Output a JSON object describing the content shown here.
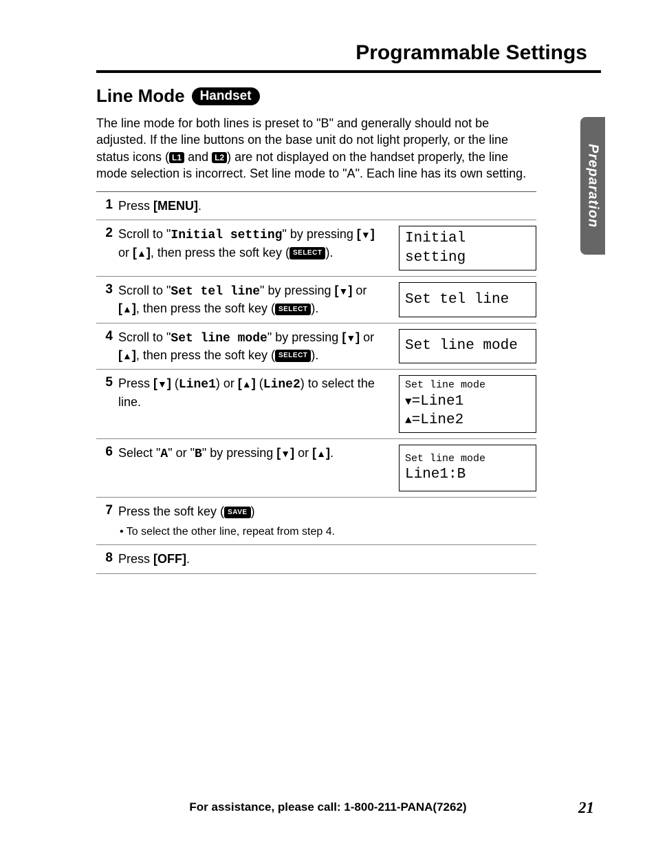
{
  "chapter_title": "Programmable Settings",
  "section": {
    "title": "Line Mode",
    "pill": "Handset"
  },
  "side_tab": "Preparation",
  "intro": {
    "p1a": "The line mode for both lines is preset to \"B\" and generally should not be adjusted. If the line buttons on the base unit do not light properly, or the line status icons (",
    "chip1": "L1",
    "p1b": " and ",
    "chip2": "L2",
    "p1c": ") are not displayed on the handset properly, the line mode selection is incorrect. Set line mode to \"A\". Each line has its own setting."
  },
  "steps": {
    "s1": {
      "num": "1",
      "a": "Press ",
      "b": "[MENU]",
      "c": "."
    },
    "s2": {
      "num": "2",
      "a": "Scroll to \"",
      "menu": "Initial setting",
      "b": "\" by pressing ",
      "k1": "[",
      "k2": "]",
      "or": " or ",
      "k3": "[",
      "k4": "]",
      "c": ", then press the soft key (",
      "sk": "SELECT",
      "d": ").",
      "lcd": "Initial setting"
    },
    "s3": {
      "num": "3",
      "a": "Scroll to \"",
      "menu": "Set tel line",
      "b": "\" by pressing ",
      "k1": "[",
      "k2": "]",
      "or": " or ",
      "k3": "[",
      "k4": "]",
      "c": ", then press the soft key (",
      "sk": "SELECT",
      "d": ").",
      "lcd": "Set tel line"
    },
    "s4": {
      "num": "4",
      "a": "Scroll to \"",
      "menu": "Set line mode",
      "b": "\" by pressing ",
      "k1": "[",
      "k2": "]",
      "or": " or ",
      "k3": "[",
      "k4": "]",
      "c": ", then press the soft key (",
      "sk": "SELECT",
      "d": ").",
      "lcd": "Set line mode"
    },
    "s5": {
      "num": "5",
      "a": "Press ",
      "k1": "[",
      "k2": "]",
      "p1": " (",
      "l1": "Line1",
      "p2": ") or ",
      "k3": "[",
      "k4": "]",
      "p3": " (",
      "l2": "Line2",
      "c": ") to select the line.",
      "lcd_a": "Set line mode",
      "lcd_b1": "=Line1 ",
      "lcd_b2": "=Line2"
    },
    "s6": {
      "num": "6",
      "a": "Select \"",
      "oa": "A",
      "b": "\" or \"",
      "ob": "B",
      "c": "\" by pressing ",
      "k1": "[",
      "k2": "]",
      "or": " or ",
      "k3": "[",
      "k4": "]",
      "d": ".",
      "lcd_a": "Set line mode",
      "lcd_b": "Line1:B"
    },
    "s7": {
      "num": "7",
      "a": "Press the soft key (",
      "sk": "SAVE",
      "b": ")",
      "bullet": "• To select the other line, repeat from step 4."
    },
    "s8": {
      "num": "8",
      "a": "Press ",
      "b": "[OFF]",
      "c": "."
    }
  },
  "footer": "For assistance, please call: 1-800-211-PANA(7262)",
  "page_num": "21"
}
